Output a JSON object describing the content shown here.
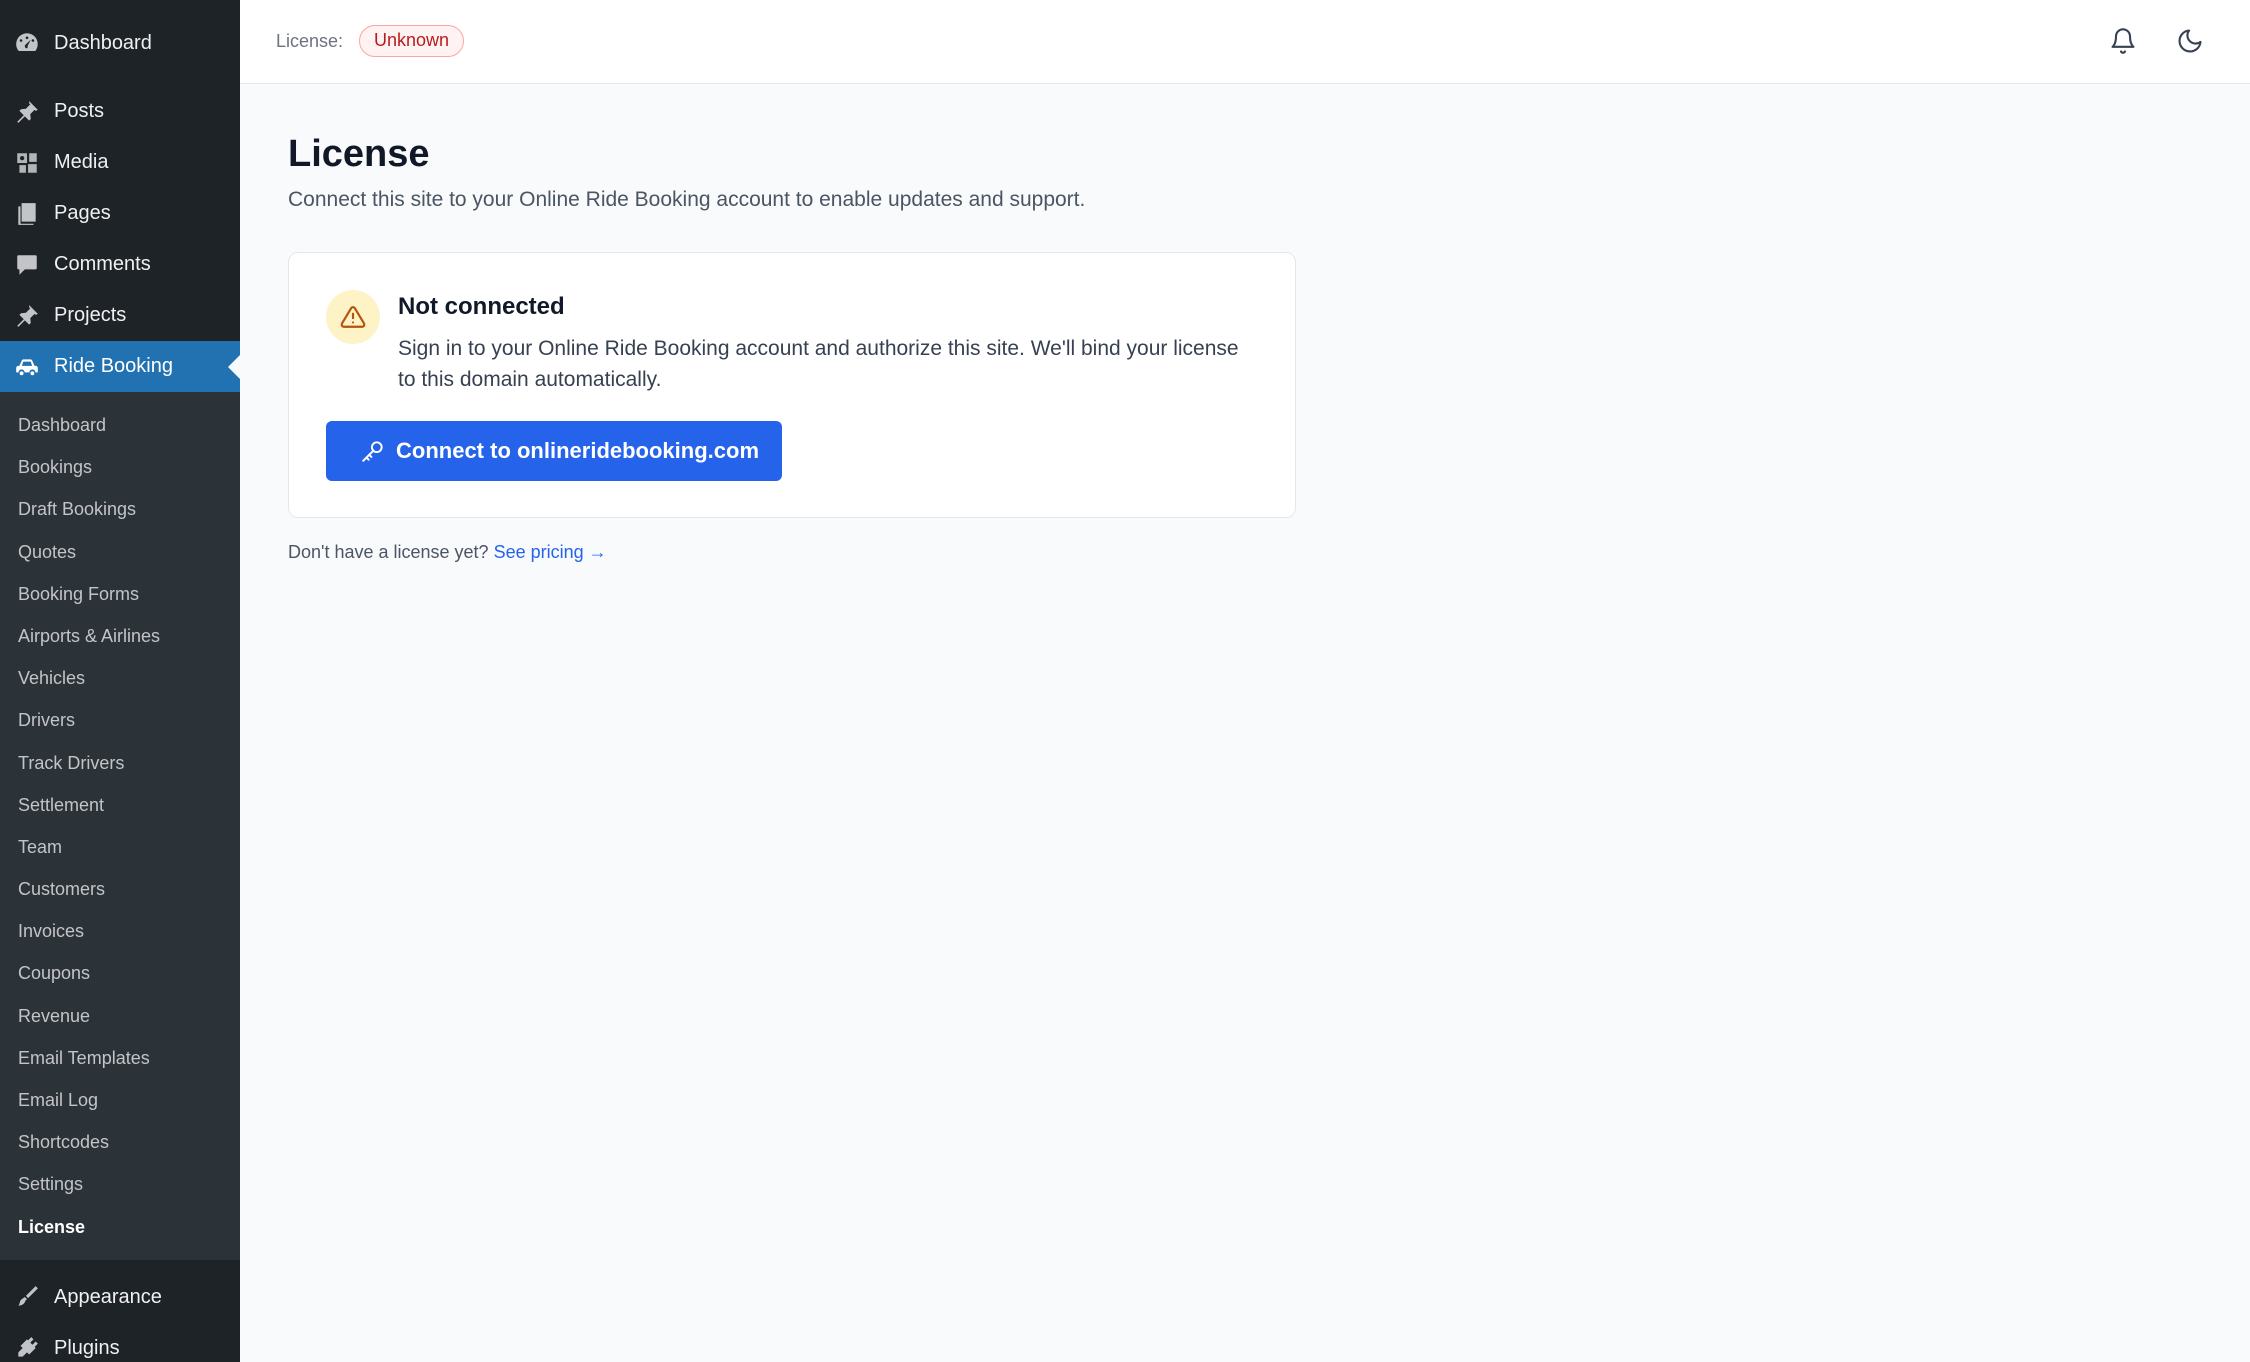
{
  "sidebar": {
    "top_items": [
      {
        "label": "Dashboard",
        "icon": "dashboard-icon"
      },
      {
        "label": "Posts",
        "icon": "pin-icon"
      },
      {
        "label": "Media",
        "icon": "media-icon"
      },
      {
        "label": "Pages",
        "icon": "pages-icon"
      },
      {
        "label": "Comments",
        "icon": "comment-icon"
      },
      {
        "label": "Projects",
        "icon": "pin-icon"
      },
      {
        "label": "Ride Booking",
        "icon": "car-icon"
      }
    ],
    "submenu": [
      "Dashboard",
      "Bookings",
      "Draft Bookings",
      "Quotes",
      "Booking Forms",
      "Airports & Airlines",
      "Vehicles",
      "Drivers",
      "Track Drivers",
      "Settlement",
      "Team",
      "Customers",
      "Invoices",
      "Coupons",
      "Revenue",
      "Email Templates",
      "Email Log",
      "Shortcodes",
      "Settings",
      "License"
    ],
    "bottom_items": [
      {
        "label": "Appearance",
        "icon": "brush-icon"
      },
      {
        "label": "Plugins",
        "icon": "plug-icon"
      }
    ]
  },
  "topbar": {
    "license_label": "License:",
    "license_status": "Unknown",
    "icons": [
      "bell-icon",
      "moon-icon"
    ]
  },
  "main": {
    "title": "License",
    "subtitle": "Connect this site to your Online Ride Booking account to enable updates and support.",
    "card": {
      "title": "Not connected",
      "text": "Sign in to your Online Ride Booking account and authorize this site. We'll bind your license to this domain automatically.",
      "button_label": "Connect to onlineridebooking.com"
    },
    "footnote_text": "Don't have a license yet?",
    "footnote_link": "See pricing →"
  },
  "colors": {
    "sidebar_bg": "#1d2327",
    "active_bg": "#2271b1",
    "primary": "#2563eb",
    "badge_text": "#b91c1c",
    "warn_bg": "#fef3c7"
  }
}
